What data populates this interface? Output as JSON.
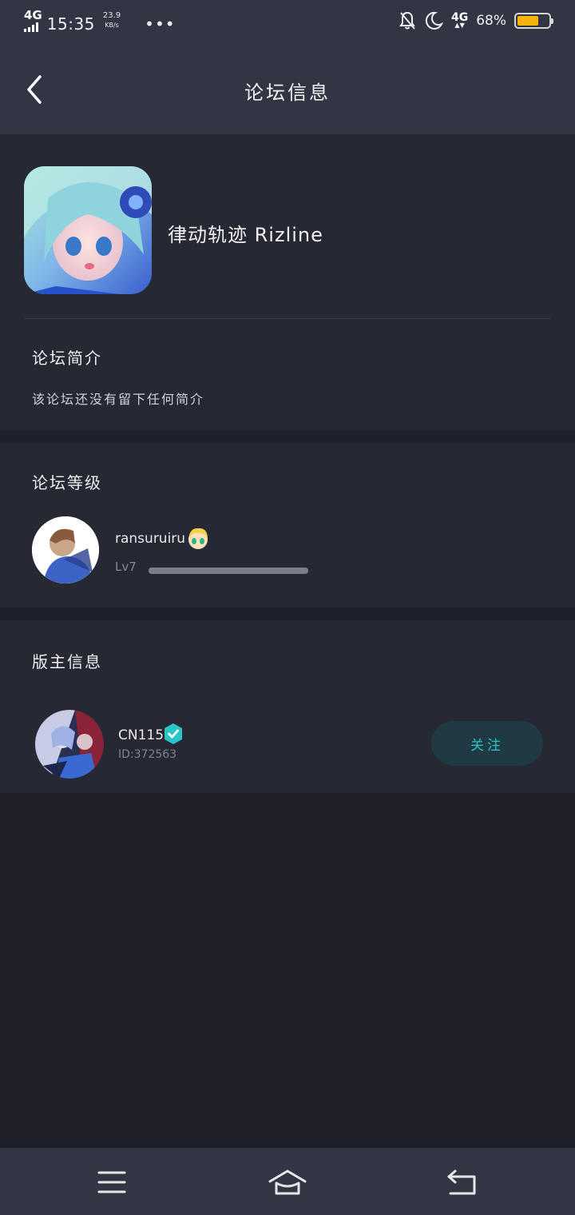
{
  "status_bar": {
    "network": "4G",
    "time": "15:35",
    "speed_value": "23.9",
    "speed_unit": "KB/s",
    "more": "•••",
    "network_right": "4G",
    "network_right_arrows": "▲▼",
    "battery_percent": "68%",
    "battery_level": 0.68,
    "battery_color": "#f6b20f"
  },
  "header": {
    "title": "论坛信息",
    "back_icon": "chevron-left-icon"
  },
  "forum": {
    "name": "律动轨迹 Rizline",
    "intro_label": "论坛简介",
    "intro_text": "该论坛还没有留下任何简介"
  },
  "level_section": {
    "label": "论坛等级",
    "username": "ransuruiru",
    "level": "Lv7",
    "progress": 1.0
  },
  "moderator_section": {
    "label": "版主信息",
    "name": "CN115",
    "id": "ID:372563",
    "follow_label": "关注",
    "accent": "#2bc4c8"
  },
  "nav_bar": {
    "menu_icon": "menu-icon",
    "home_icon": "home-icon",
    "back_icon": "back-icon"
  }
}
